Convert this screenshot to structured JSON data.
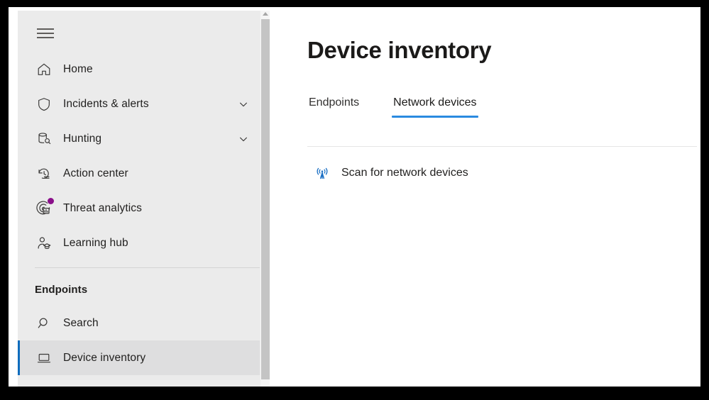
{
  "app": {
    "accent_blue": "#0f6cbd",
    "tab_underline": "#2a8ae0",
    "badge_purple": "#8a0f8a",
    "sidebar_bg": "#ebebeb",
    "selected_bg": "#dededf"
  },
  "sidebar": {
    "menu_button": "menu",
    "items": [
      {
        "label": "Home",
        "icon": "home-icon",
        "expandable": false,
        "selected": false,
        "badge": false
      },
      {
        "label": "Incidents & alerts",
        "icon": "shield-icon",
        "expandable": true,
        "selected": false,
        "badge": false
      },
      {
        "label": "Hunting",
        "icon": "database-search-icon",
        "expandable": true,
        "selected": false,
        "badge": false
      },
      {
        "label": "Action center",
        "icon": "history-clock-icon",
        "expandable": false,
        "selected": false,
        "badge": false
      },
      {
        "label": "Threat analytics",
        "icon": "threat-analytics-icon",
        "expandable": false,
        "selected": false,
        "badge": true
      },
      {
        "label": "Learning hub",
        "icon": "graduate-person-icon",
        "expandable": false,
        "selected": false,
        "badge": false
      }
    ],
    "section": {
      "title": "Endpoints",
      "items": [
        {
          "label": "Search",
          "icon": "search-icon",
          "expandable": false,
          "selected": false,
          "badge": false
        },
        {
          "label": "Device inventory",
          "icon": "laptop-icon",
          "expandable": false,
          "selected": true,
          "badge": false
        }
      ]
    }
  },
  "main": {
    "title": "Device inventory",
    "tabs": [
      {
        "label": "Endpoints",
        "active": false
      },
      {
        "label": "Network devices",
        "active": true
      }
    ],
    "actions": [
      {
        "label": "Scan for network devices",
        "icon": "broadcast-tower-icon"
      }
    ]
  }
}
